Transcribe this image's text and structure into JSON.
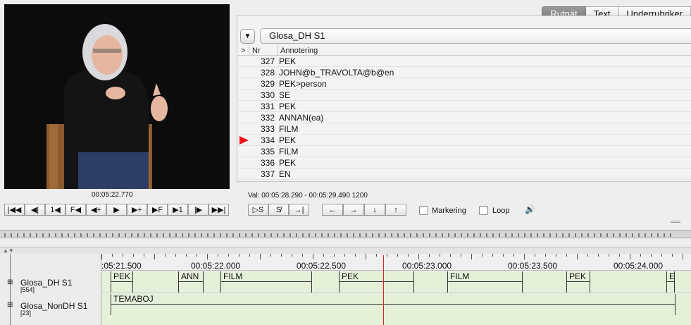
{
  "video": {
    "timecode": "00:05:22.770"
  },
  "tabs": [
    {
      "label": "Rutnät",
      "active": true
    },
    {
      "label": "Text",
      "active": false
    },
    {
      "label": "Underrubriker",
      "active": false
    }
  ],
  "grid": {
    "tier_toggle_icon": "▼",
    "tier_name": "Glosa_DH S1",
    "col_marker": ">",
    "col_nr": "Nr",
    "col_annotation": "Annotering",
    "rows": [
      {
        "nr": "327",
        "ann": "PEK",
        "current": false
      },
      {
        "nr": "328",
        "ann": "JOHN@b_TRAVOLTA@b@en",
        "current": false
      },
      {
        "nr": "329",
        "ann": "PEK>person",
        "current": false
      },
      {
        "nr": "330",
        "ann": "SE",
        "current": false
      },
      {
        "nr": "331",
        "ann": "PEK",
        "current": false
      },
      {
        "nr": "332",
        "ann": "ANNAN(ea)",
        "current": false
      },
      {
        "nr": "333",
        "ann": "FILM",
        "current": false
      },
      {
        "nr": "334",
        "ann": "PEK",
        "current": true
      },
      {
        "nr": "335",
        "ann": "FILM",
        "current": false
      },
      {
        "nr": "336",
        "ann": "PEK",
        "current": false
      },
      {
        "nr": "337",
        "ann": "EN",
        "current": false
      }
    ]
  },
  "selection": {
    "text": "Val: 00:05:28.290 - 00:05:29.490  1200"
  },
  "controls": {
    "player_buttons": [
      {
        "name": "go-to-begin-button",
        "label": "|◀◀"
      },
      {
        "name": "prev-frame-button",
        "label": "◀|"
      },
      {
        "name": "step-back-1-button",
        "label": "1◀"
      },
      {
        "name": "frame-back-button",
        "label": "F◀"
      },
      {
        "name": "prev-annotation-button",
        "label": "◀+"
      },
      {
        "name": "play-button",
        "label": "▶"
      },
      {
        "name": "next-annotation-button",
        "label": "▶+"
      },
      {
        "name": "frame-forward-button",
        "label": "▶F"
      },
      {
        "name": "step-forward-1-button",
        "label": "▶1"
      },
      {
        "name": "next-frame-button",
        "label": "|▶"
      },
      {
        "name": "go-to-end-button",
        "label": "▶▶|"
      }
    ],
    "selection_buttons": [
      {
        "name": "play-selection-button",
        "label": "▷S"
      },
      {
        "name": "clear-selection-button",
        "label": "S̸"
      },
      {
        "name": "selection-to-end-button",
        "label": "→|"
      }
    ],
    "nav_buttons": [
      {
        "name": "nav-left-button",
        "label": "←"
      },
      {
        "name": "nav-right-button",
        "label": "→"
      },
      {
        "name": "nav-down-button",
        "label": "↓"
      },
      {
        "name": "nav-up-button",
        "label": "↑"
      }
    ],
    "markering_label": "Markering",
    "loop_label": "Loop",
    "speaker_icon": "🔊"
  },
  "timeline": {
    "ruler_ticks": [
      ":05:21.500",
      "00:05:22.000",
      "00:05:22.500",
      "00:05:23.000",
      "00:05:23.500",
      "00:05:24.000"
    ],
    "tiers": [
      {
        "name": "Glosa_DH S1",
        "count": "[554]"
      },
      {
        "name": "Glosa_NonDH S1",
        "count": "[23]"
      }
    ],
    "tier1_segments": [
      "PEK",
      "ANN",
      "FILM",
      "PEK",
      "FILM",
      "PEK",
      "E"
    ],
    "tier2_segments": [
      "TEMABOJ"
    ]
  },
  "colors": {
    "cursor": "#dd2222",
    "track_bg": "#e4f0d8",
    "active_tab": "#8a8a8a",
    "current_marker": "#ee1111"
  }
}
